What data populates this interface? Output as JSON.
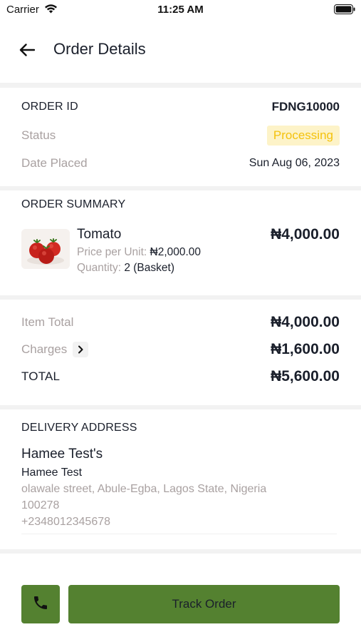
{
  "status_bar": {
    "carrier": "Carrier",
    "time": "11:25 AM"
  },
  "header": {
    "title": "Order Details"
  },
  "order_info": {
    "order_id_label": "ORDER ID",
    "order_id_value": "FDNG10000",
    "status_label": "Status",
    "status_value": "Processing",
    "date_label": "Date Placed",
    "date_value": "Sun Aug 06, 2023"
  },
  "summary": {
    "title": "ORDER SUMMARY",
    "item": {
      "name": "Tomato",
      "price": "₦4,000.00",
      "unit_price_label": "Price per Unit:",
      "unit_price_value": "₦2,000.00",
      "quantity_label": "Quantity:",
      "quantity_value": "2 (Basket)"
    }
  },
  "totals": {
    "item_total_label": "Item Total",
    "item_total_value": "₦4,000.00",
    "charges_label": "Charges",
    "charges_value": "₦1,600.00",
    "total_label": "TOTAL",
    "total_value": "₦5,600.00"
  },
  "delivery": {
    "title": "DELIVERY ADDRESS",
    "address_name": "Hamee Test's",
    "recipient": "Hamee Test",
    "street": "olawale street, Abule-Egba, Lagos State, Nigeria",
    "postal_code": "100278",
    "phone": "+2348012345678"
  },
  "actions": {
    "track_label": "Track Order"
  },
  "colors": {
    "accent": "#548130",
    "status_text": "#f4c20d",
    "status_bg": "#fdf3c8",
    "muted": "#a9a1a1"
  },
  "icons": {
    "back": "arrow-left-icon",
    "charges": "chevron-right-icon",
    "call": "phone-icon"
  }
}
